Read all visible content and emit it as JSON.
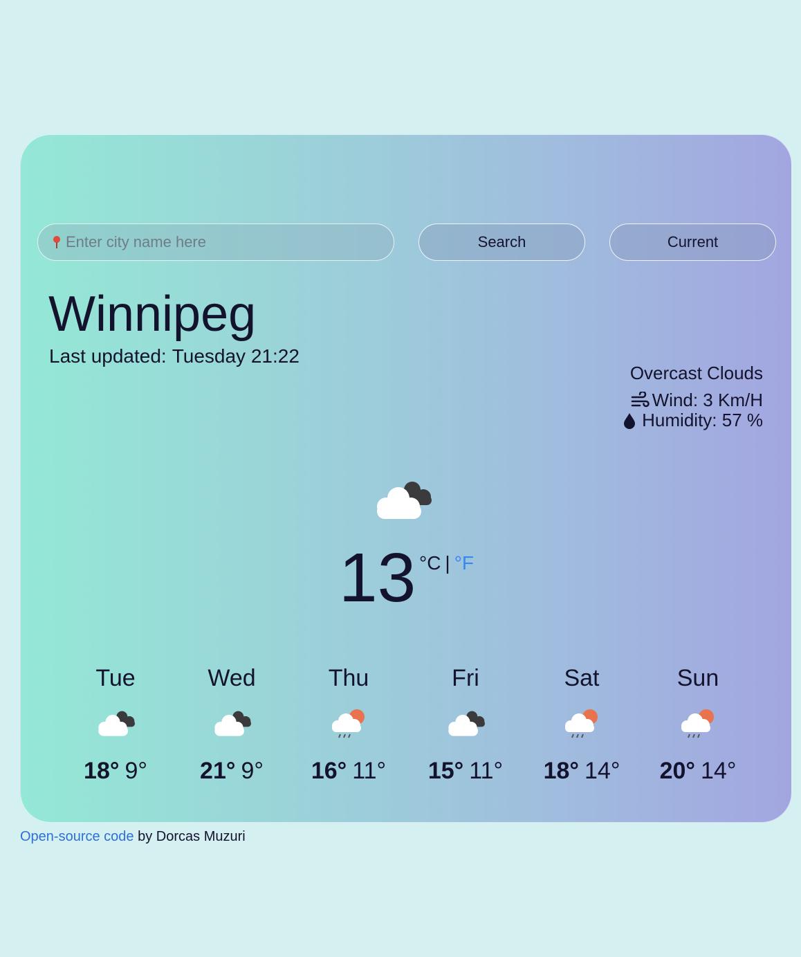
{
  "search": {
    "placeholder": "Enter city name here",
    "value": ""
  },
  "buttons": {
    "search": "Search",
    "current": "Current"
  },
  "city": "Winnipeg",
  "updated": {
    "label": "Last updated:",
    "value": "Tuesday 21:22"
  },
  "conditions": {
    "description": "Overcast Clouds",
    "wind": "Wind: 3 Km/H",
    "humidity": "Humidity: 57 %"
  },
  "current": {
    "icon": "overcast-clouds-icon",
    "temperature": "13",
    "unit_c": "°C",
    "separator": "|",
    "unit_f": "°F"
  },
  "forecast": [
    {
      "day": "Tue",
      "max": "18°",
      "min": "9°",
      "icon": "overcast-clouds-icon"
    },
    {
      "day": "Wed",
      "max": "21°",
      "min": "9°",
      "icon": "overcast-clouds-icon"
    },
    {
      "day": "Thu",
      "max": "16°",
      "min": "11°",
      "icon": "sun-rain-cloud-icon"
    },
    {
      "day": "Fri",
      "max": "15°",
      "min": "11°",
      "icon": "overcast-clouds-icon"
    },
    {
      "day": "Sat",
      "max": "18°",
      "min": "14°",
      "icon": "sun-rain-cloud-icon"
    },
    {
      "day": "Sun",
      "max": "20°",
      "min": "14°",
      "icon": "sun-rain-cloud-icon"
    }
  ],
  "footer": {
    "link_text": "Open-source code",
    "suffix": "by Dorcas Muzuri"
  },
  "colors": {
    "accent_link": "#3a86f0",
    "text": "#14132e",
    "background": "#d4f0f1"
  }
}
